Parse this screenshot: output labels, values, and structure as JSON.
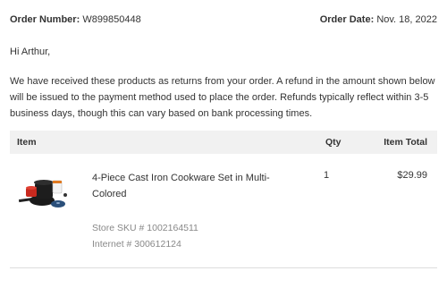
{
  "order": {
    "number_label": "Order Number:",
    "number_value": "W899850448",
    "date_label": "Order Date:",
    "date_value": "Nov. 18, 2022"
  },
  "greeting": "Hi Arthur,",
  "message": "We have received these products as returns from your order. A refund in the amount shown below will be issued to the payment method used to place the order. Refunds typically reflect within 3-5 business days, though this can vary based on bank processing times.",
  "table": {
    "headers": {
      "item": "Item",
      "qty": "Qty",
      "total": "Item Total"
    },
    "rows": [
      {
        "name": "4-Piece Cast Iron Cookware Set in Multi-Colored",
        "qty": "1",
        "total": "$29.99",
        "store_sku": "Store SKU # 1002164511",
        "internet": "Internet # 300612124",
        "image_icon": "cookware-set-product-image"
      }
    ]
  }
}
